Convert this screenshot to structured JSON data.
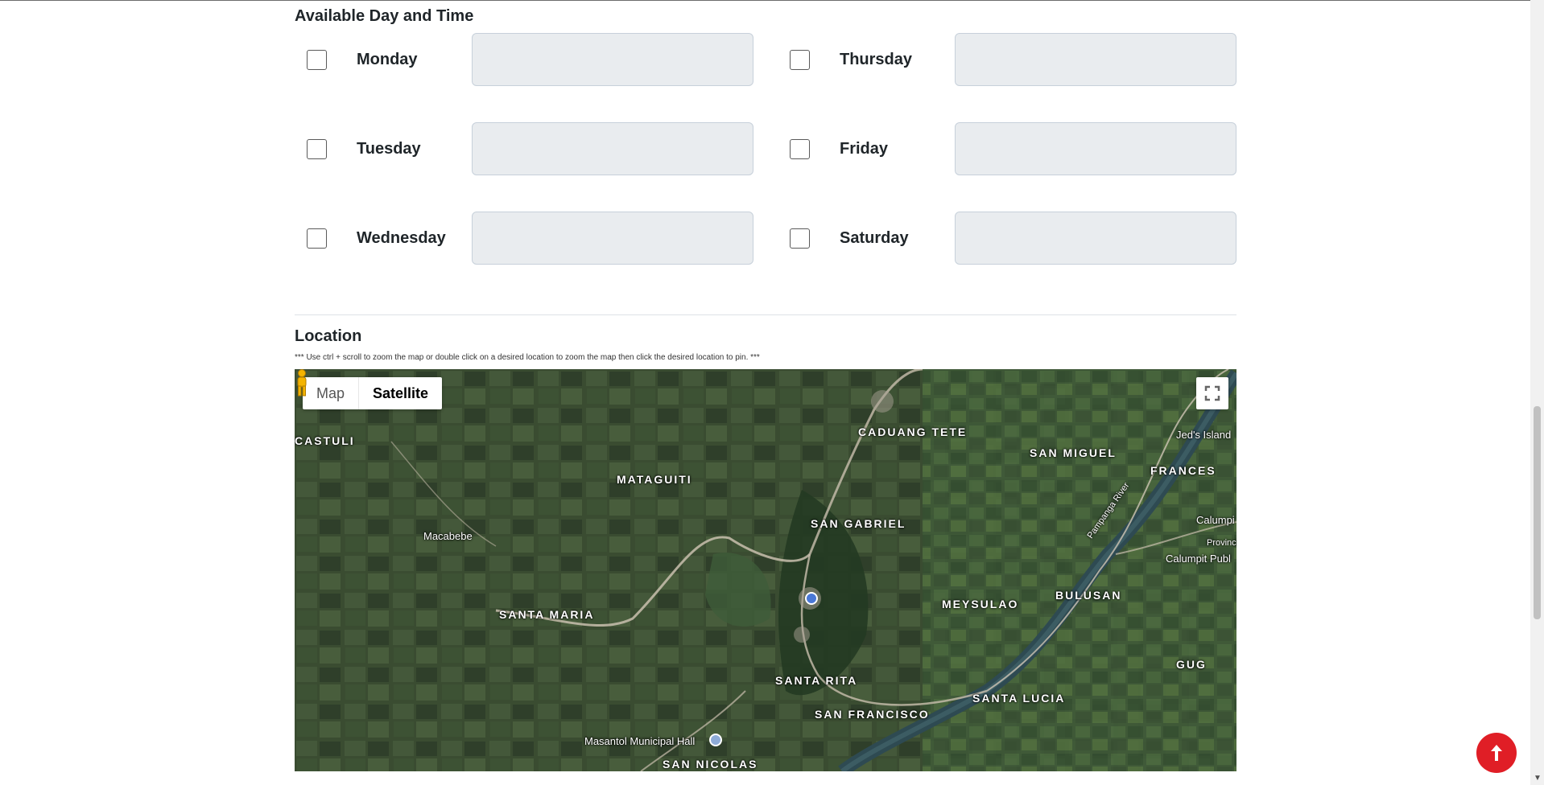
{
  "availability": {
    "title": "Available Day and Time",
    "days": {
      "monday": "Monday",
      "tuesday": "Tuesday",
      "wednesday": "Wednesday",
      "thursday": "Thursday",
      "friday": "Friday",
      "saturday": "Saturday"
    }
  },
  "location": {
    "title": "Location",
    "hint": "*** Use ctrl + scroll to zoom the map or double click on a desired location to zoom the map then click the desired location to pin. ***"
  },
  "map": {
    "type_buttons": {
      "map": "Map",
      "satellite": "Satellite"
    },
    "selected_type": "Satellite",
    "labels": {
      "castuli": "CASTULI",
      "caduang_tete": "CADUANG TETE",
      "jeds_island": "Jed's Island",
      "san_miguel": "SAN MIGUEL",
      "frances": "FRANCES",
      "mataguiti": "MATAGUITI",
      "san_gabriel": "SAN GABRIEL",
      "macabebe": "Macabebe",
      "calumpit": "Calumpi",
      "provincial": "Provinci",
      "calumpit_public": "Calumpit Publ",
      "meysulao": "MEYSULAO",
      "bulusan": "BULUSAN",
      "santa_maria": "SANTA MARIA",
      "gug": "GUG",
      "santa_rita": "SANTA RITA",
      "santa_lucia": "SANTA LUCIA",
      "san_francisco": "SAN FRANCISCO",
      "masantol_hall": "Masantol Municipal Hall",
      "san_nicolas": "SAN NICOLAS",
      "pampanga_river": "Pampanga River"
    },
    "colors": {
      "satellite_base": "#34452e",
      "river": "#2e4a52",
      "road": "#c9bfae"
    }
  },
  "colors": {
    "back_to_top": "#e01e26",
    "input_bg": "#e9ecef"
  }
}
